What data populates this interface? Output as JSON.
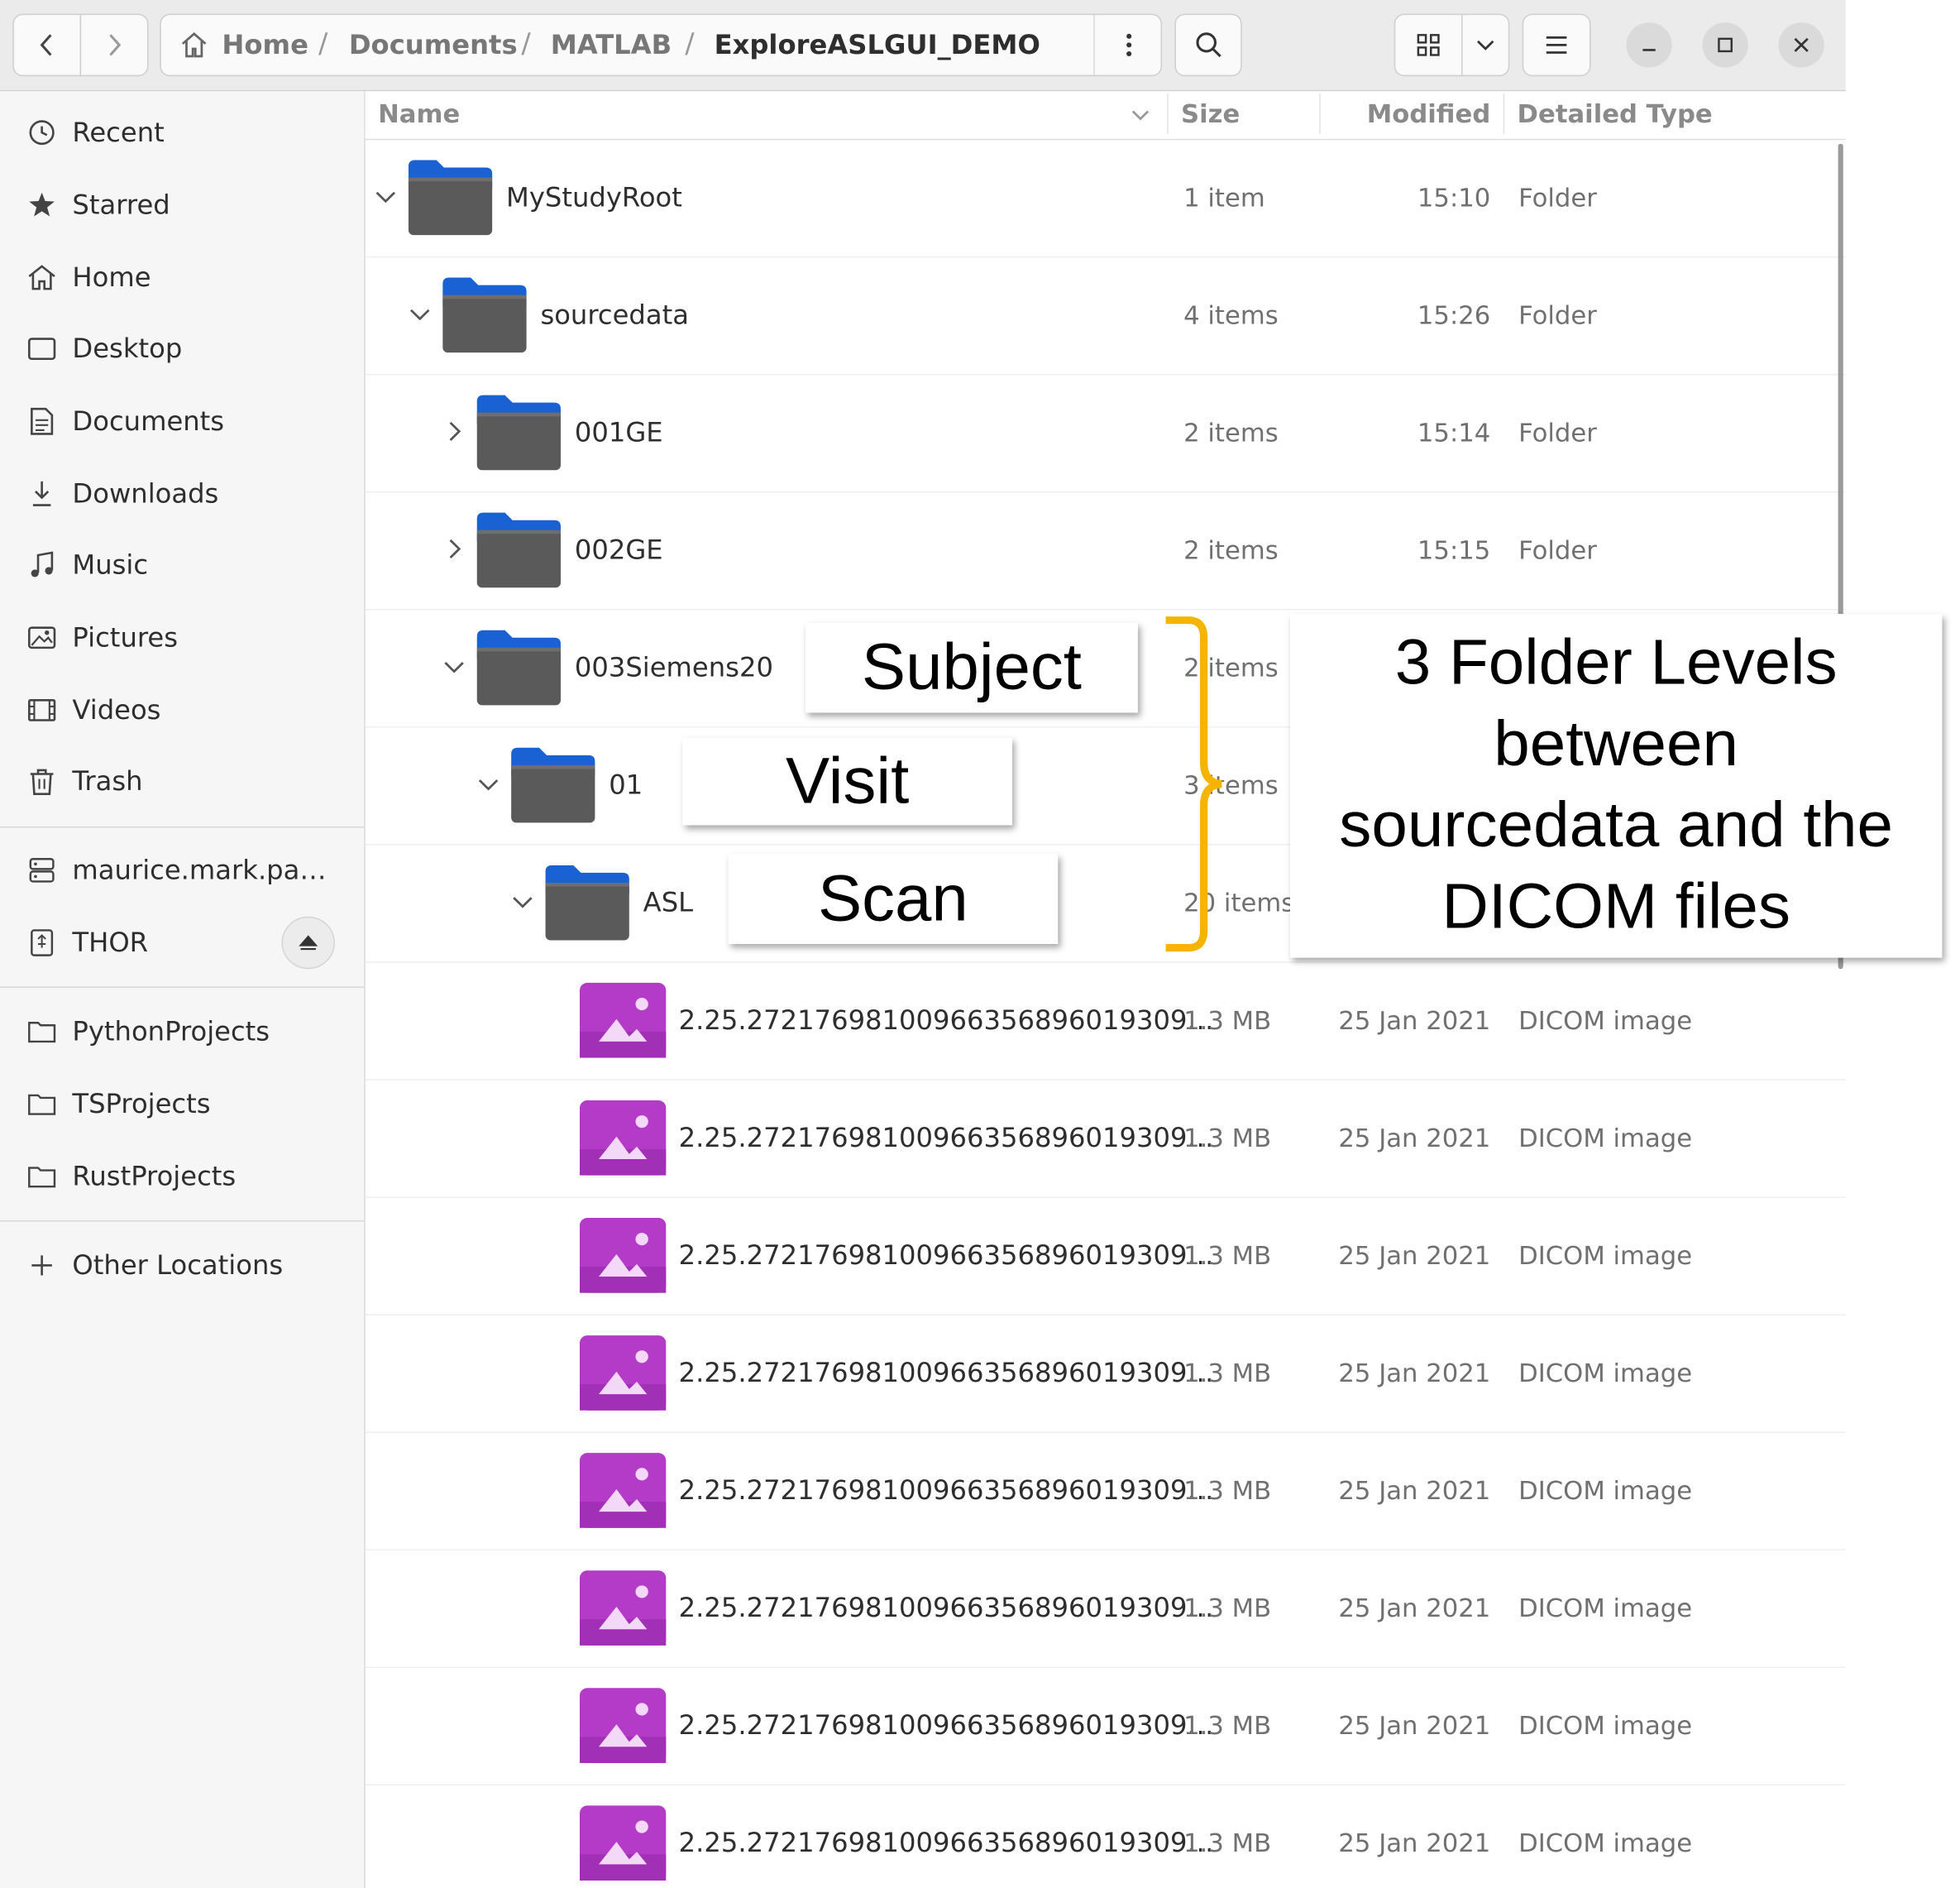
{
  "path": [
    "Home",
    "Documents",
    "MATLAB",
    "ExploreASLGUI_DEMO"
  ],
  "sidebar": {
    "places": [
      "Recent",
      "Starred",
      "Home",
      "Desktop",
      "Documents",
      "Downloads",
      "Music",
      "Pictures",
      "Videos",
      "Trash"
    ],
    "devices": [
      "maurice.mark.pa…",
      "THOR"
    ],
    "bookmarks": [
      "PythonProjects",
      "TSProjects",
      "RustProjects"
    ],
    "other": "Other Locations"
  },
  "columns": {
    "name": "Name",
    "size": "Size",
    "modified": "Modified",
    "type": "Detailed Type"
  },
  "rows": [
    {
      "name": "MyStudyRoot",
      "size": "1 item",
      "modified": "15:10",
      "type": "Folder",
      "depth": 0,
      "expanded": true,
      "kind": "folder"
    },
    {
      "name": "sourcedata",
      "size": "4 items",
      "modified": "15:26",
      "type": "Folder",
      "depth": 1,
      "expanded": true,
      "kind": "folder"
    },
    {
      "name": "001GE",
      "size": "2 items",
      "modified": "15:14",
      "type": "Folder",
      "depth": 2,
      "expanded": false,
      "kind": "folder"
    },
    {
      "name": "002GE",
      "size": "2 items",
      "modified": "15:15",
      "type": "Folder",
      "depth": 2,
      "expanded": false,
      "kind": "folder"
    },
    {
      "name": "003Siemens20",
      "size": "2 items",
      "modified": "",
      "type": "",
      "depth": 2,
      "expanded": true,
      "kind": "folder"
    },
    {
      "name": "01",
      "size": "3 items",
      "modified": "",
      "type": "",
      "depth": 3,
      "expanded": true,
      "kind": "folder"
    },
    {
      "name": "ASL",
      "size": "20 items",
      "modified": "",
      "type": "",
      "depth": 4,
      "expanded": true,
      "kind": "folder"
    },
    {
      "name": "2.25.27217698100966356896019309…",
      "size": "1.3 MB",
      "modified": "25 Jan 2021",
      "type": "DICOM image",
      "depth": 5,
      "kind": "image"
    },
    {
      "name": "2.25.27217698100966356896019309…",
      "size": "1.3 MB",
      "modified": "25 Jan 2021",
      "type": "DICOM image",
      "depth": 5,
      "kind": "image"
    },
    {
      "name": "2.25.27217698100966356896019309…",
      "size": "1.3 MB",
      "modified": "25 Jan 2021",
      "type": "DICOM image",
      "depth": 5,
      "kind": "image"
    },
    {
      "name": "2.25.27217698100966356896019309…",
      "size": "1.3 MB",
      "modified": "25 Jan 2021",
      "type": "DICOM image",
      "depth": 5,
      "kind": "image"
    },
    {
      "name": "2.25.27217698100966356896019309…",
      "size": "1.3 MB",
      "modified": "25 Jan 2021",
      "type": "DICOM image",
      "depth": 5,
      "kind": "image"
    },
    {
      "name": "2.25.27217698100966356896019309…",
      "size": "1.3 MB",
      "modified": "25 Jan 2021",
      "type": "DICOM image",
      "depth": 5,
      "kind": "image"
    },
    {
      "name": "2.25.27217698100966356896019309…",
      "size": "1.3 MB",
      "modified": "25 Jan 2021",
      "type": "DICOM image",
      "depth": 5,
      "kind": "image"
    },
    {
      "name": "2.25.27217698100966356896019309…",
      "size": "1.3 MB",
      "modified": "25 Jan 2021",
      "type": "DICOM image",
      "depth": 5,
      "kind": "image"
    }
  ],
  "annotations": {
    "subject": "Subject",
    "visit": "Visit",
    "scan": "Scan",
    "explanation": [
      "3 Folder Levels",
      "between",
      "sourcedata and the",
      "DICOM files"
    ]
  },
  "colors": {
    "brace": "#f5b400",
    "folder_tab": "#1a62d4",
    "folder_body": "#5a5a5a",
    "image_icon": "#b43bc8"
  }
}
